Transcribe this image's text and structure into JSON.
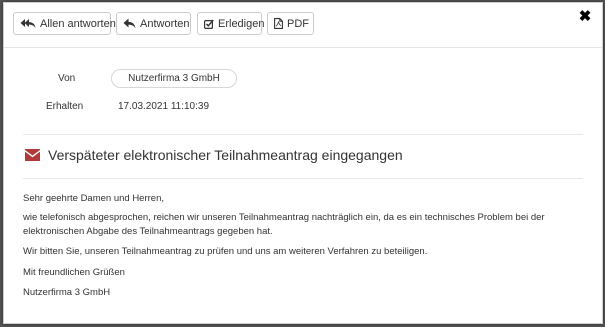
{
  "toolbar": {
    "reply_all_label": "Allen antworten",
    "reply_label": "Antworten",
    "done_label": "Erledigen",
    "pdf_label": "PDF",
    "close_glyph": "✖"
  },
  "header": {
    "from_label": "Von",
    "from_value": "Nutzerfirma 3 GmbH",
    "received_label": "Erhalten",
    "received_value": "17.03.2021 11:10:39"
  },
  "subject": {
    "icon": "envelope-icon",
    "icon_color": "#b03a3a",
    "text": "Verspäteter elektronischer Teilnahmeantrag eingegangen"
  },
  "body": {
    "greeting": "Sehr geehrte Damen und Herren,",
    "paragraph_main": "wie telefonisch abgesprochen, reichen wir unseren Teilnahmeantrag nachträglich ein, da es ein technisches Problem bei der elektronischen Abgabe des Teilnahmeantrags gegeben hat.",
    "paragraph_request": "Wir bitten Sie, unseren Teilnahmeantrag zu prüfen und uns am weiteren Verfahren zu beteiligen.",
    "closing": "Mit freundlichen Grüßen",
    "signature": "Nutzerfirma 3 GmbH"
  }
}
